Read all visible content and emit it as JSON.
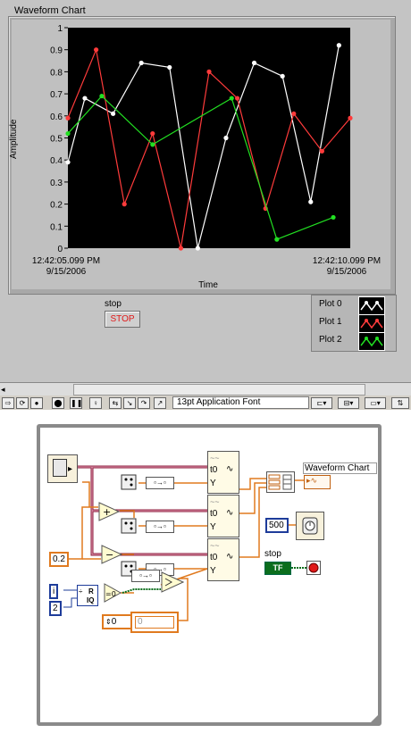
{
  "front_panel": {
    "chart_title": "Waveform Chart",
    "stop_label": "stop",
    "stop_button": "STOP",
    "legend": [
      {
        "name": "Plot 0",
        "color": "#ffffff"
      },
      {
        "name": "Plot 1",
        "color": "#ff3b3b"
      },
      {
        "name": "Plot 2",
        "color": "#22e022"
      }
    ],
    "toolbar_font": "13pt Application Font"
  },
  "chart_data": {
    "type": "line",
    "xlabel": "Time",
    "ylabel": "Amplitude",
    "ylim": [
      0,
      1
    ],
    "yticks": [
      "1",
      "0.9",
      "0.8",
      "0.7",
      "0.6",
      "0.5",
      "0.4",
      "0.3",
      "0.2",
      "0.1",
      "0"
    ],
    "x_start": "12:42:05.099 PM\n9/15/2006",
    "x_end": "12:42:10.099 PM\n9/15/2006",
    "x_start_time": "12:42:05.099 PM",
    "x_start_date": "9/15/2006",
    "x_end_time": "12:42:10.099 PM",
    "x_end_date": "9/15/2006",
    "series": [
      {
        "name": "Plot 0",
        "color": "#ffffff",
        "points": [
          [
            0,
            0.39
          ],
          [
            0.6,
            0.68
          ],
          [
            1.6,
            0.61
          ],
          [
            2.6,
            0.84
          ],
          [
            3.6,
            0.82
          ],
          [
            4.6,
            0.0
          ],
          [
            5.6,
            0.5
          ],
          [
            6.6,
            0.84
          ],
          [
            7.6,
            0.78
          ],
          [
            8.6,
            0.21
          ],
          [
            9.6,
            0.92
          ]
        ]
      },
      {
        "name": "Plot 1",
        "color": "#ff3b3b",
        "points": [
          [
            0,
            0.59
          ],
          [
            1.0,
            0.9
          ],
          [
            2.0,
            0.2
          ],
          [
            3.0,
            0.52
          ],
          [
            4.0,
            0.0
          ],
          [
            5.0,
            0.8
          ],
          [
            6.0,
            0.68
          ],
          [
            7.0,
            0.18
          ],
          [
            8.0,
            0.61
          ],
          [
            9.0,
            0.44
          ],
          [
            10.0,
            0.59
          ]
        ]
      },
      {
        "name": "Plot 2",
        "color": "#22e022",
        "points": [
          [
            0,
            0.52
          ],
          [
            1.2,
            0.69
          ],
          [
            3.0,
            0.47
          ],
          [
            5.8,
            0.68
          ],
          [
            7.4,
            0.04
          ],
          [
            9.4,
            0.14
          ]
        ]
      }
    ]
  },
  "block_diagram": {
    "chart_label": "Waveform Chart",
    "t0": "t0",
    "y": "Y",
    "const_02": "0.2",
    "wait_ms": "500",
    "stop_label": "stop",
    "tf": "TF",
    "i_label": "i",
    "const_2": "2",
    "q_label": "R\nIQ",
    "r_label": "R",
    "iq_label": "IQ",
    "zero": "0",
    "shift_init": "0",
    "shift_value": "0",
    "plus": "+",
    "minus": "−",
    "eq0": "=0"
  }
}
